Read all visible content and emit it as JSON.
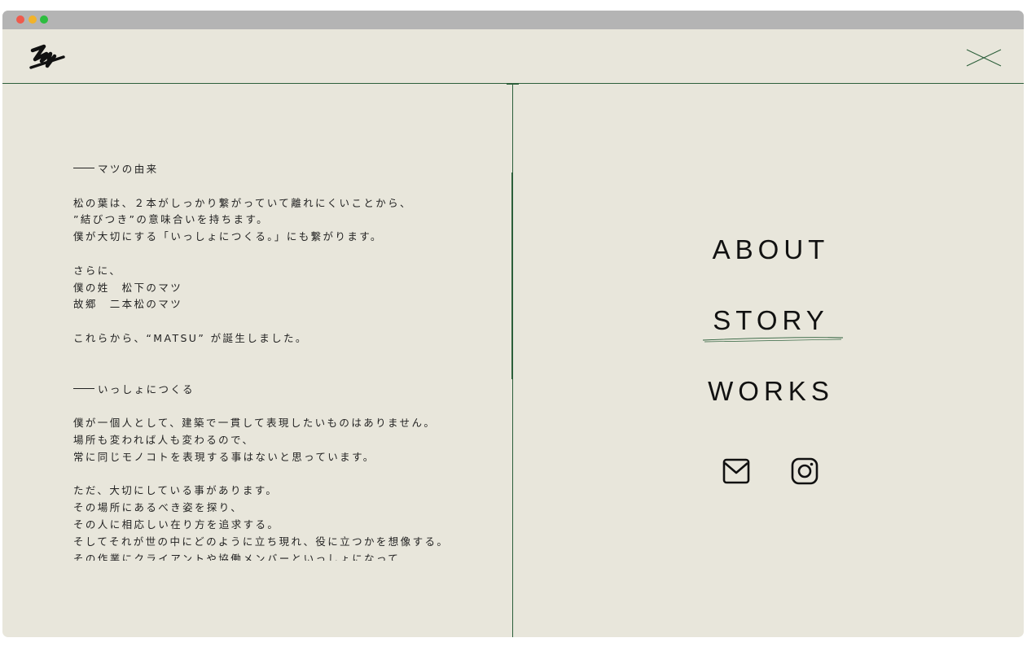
{
  "window": {
    "controls": [
      "close",
      "minimize",
      "zoom"
    ],
    "logo_icon": "matsu-logo-icon",
    "close_icon": "close-x-icon"
  },
  "story": {
    "section1": {
      "heading": "マツの由来",
      "para1": [
        "松の葉は、２本がしっかり繋がっていて離れにくいことから、",
        "”結びつき”の意味合いを持ちます。",
        "僕が大切にする「いっしょにつくる。」にも繋がります。"
      ],
      "para2": [
        "さらに、",
        "僕の姓　松下のマツ",
        "故郷　二本松のマツ"
      ],
      "para3": "これらから、“MATSU” が誕生しました。"
    },
    "section2": {
      "heading": "いっしょにつくる",
      "para1": [
        "僕が一個人として、建築で一貫して表現したいものはありません。",
        "場所も変われば人も変わるので、",
        "常に同じモノコトを表現する事はないと思っています。"
      ],
      "para2": [
        "ただ、大切にしている事があります。",
        "その場所にあるべき姿を探り、",
        "その人に相応しい在り方を追求する。",
        "そしてそれが世の中にどのように立ち現れ、役に立つかを想像する。",
        "その作業にクライアントや協働メンバーといっしょになって"
      ]
    }
  },
  "nav": {
    "items": [
      "ABOUT",
      "STORY",
      "WORKS"
    ],
    "active": "STORY"
  },
  "social": {
    "mail_icon": "mail-icon",
    "instagram_icon": "instagram-icon"
  },
  "colors": {
    "background": "#e8e6db",
    "accent": "#2c5f3a",
    "text": "#111111",
    "titlebar": "#b4b4b4"
  }
}
